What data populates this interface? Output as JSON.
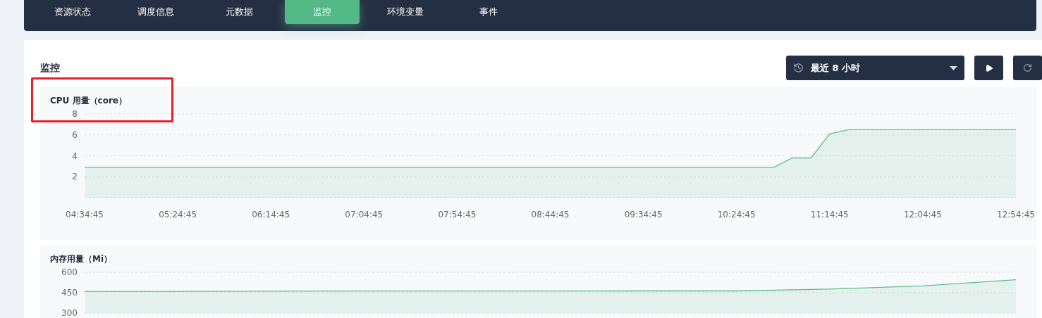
{
  "tabs": [
    {
      "label": "资源状态",
      "selected": false
    },
    {
      "label": "调度信息",
      "selected": false
    },
    {
      "label": "元数据",
      "selected": false
    },
    {
      "label": "监控",
      "selected": true
    },
    {
      "label": "环境变量",
      "selected": false
    },
    {
      "label": "事件",
      "selected": false
    }
  ],
  "panel": {
    "title": "监控",
    "time_range": {
      "value": "最近 8 小时"
    }
  },
  "charts": [
    {
      "title": "CPU 用量（core）",
      "chart_data": {
        "type": "area",
        "grid": true,
        "ylim": [
          0,
          8
        ],
        "yticks": [
          2,
          4,
          6,
          8
        ],
        "categories": [
          "04:34:45",
          null,
          null,
          null,
          null,
          "05:24:45",
          null,
          null,
          null,
          null,
          "06:14:45",
          null,
          null,
          null,
          null,
          "07:04:45",
          null,
          null,
          null,
          null,
          "07:54:45",
          null,
          null,
          null,
          null,
          "08:44:45",
          null,
          null,
          null,
          null,
          "09:34:45",
          null,
          null,
          null,
          null,
          "10:24:45",
          null,
          null,
          null,
          null,
          "11:14:45",
          null,
          null,
          null,
          null,
          "12:04:45",
          null,
          null,
          null,
          null,
          "12:54:45"
        ],
        "series": [
          {
            "color": "#5cc08e",
            "values": [
              2.9,
              2.9,
              2.9,
              2.9,
              2.9,
              2.9,
              2.9,
              2.9,
              2.9,
              2.9,
              2.9,
              2.9,
              2.9,
              2.9,
              2.9,
              2.9,
              2.9,
              2.9,
              2.9,
              2.9,
              2.9,
              2.9,
              2.9,
              2.9,
              2.9,
              2.9,
              2.9,
              2.9,
              2.9,
              2.9,
              2.9,
              2.9,
              2.9,
              2.9,
              2.9,
              2.9,
              2.9,
              2.9,
              3.8,
              3.8,
              6.1,
              6.5,
              6.5,
              6.5,
              6.5,
              6.5,
              6.5,
              6.5,
              6.5,
              6.5,
              6.5
            ]
          }
        ]
      }
    },
    {
      "title": "内存用量（Mi）",
      "chart_data": {
        "type": "area",
        "grid": true,
        "ylim": [
          300,
          600
        ],
        "yticks": [
          300,
          450,
          600
        ],
        "series": [
          {
            "color": "#5cc08e",
            "values": [
              460,
              460,
              461,
              462,
              462,
              462,
              463,
              463,
              477,
              500,
              545
            ]
          }
        ]
      }
    }
  ]
}
